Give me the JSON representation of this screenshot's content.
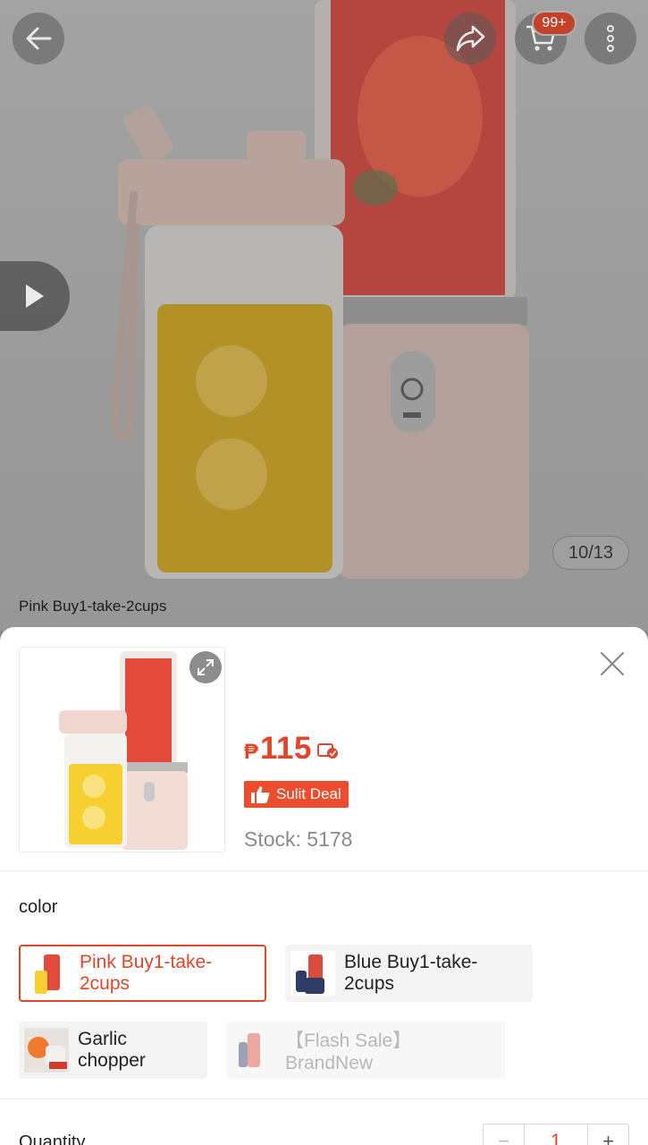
{
  "header": {
    "cart_badge": "99+",
    "image_counter": "10/13",
    "variant_caption": "Pink Buy1-take-2cups"
  },
  "product": {
    "currency": "₱",
    "price": "115",
    "deal_label": "Sulit Deal",
    "stock": "Stock: 5178"
  },
  "variation": {
    "label": "color",
    "options": [
      {
        "label": "Pink Buy1-take-2cups",
        "state": "selected"
      },
      {
        "label": "Blue Buy1-take-2cups",
        "state": "available"
      },
      {
        "label": "Garlic chopper",
        "state": "available"
      },
      {
        "label": "【Flash Sale】BrandNew",
        "state": "disabled"
      }
    ]
  },
  "quantity": {
    "label": "Quantity",
    "value": "1",
    "minus": "−",
    "plus": "+"
  },
  "colors": {
    "accent": "#ee4d2d",
    "price": "#e0462c"
  }
}
